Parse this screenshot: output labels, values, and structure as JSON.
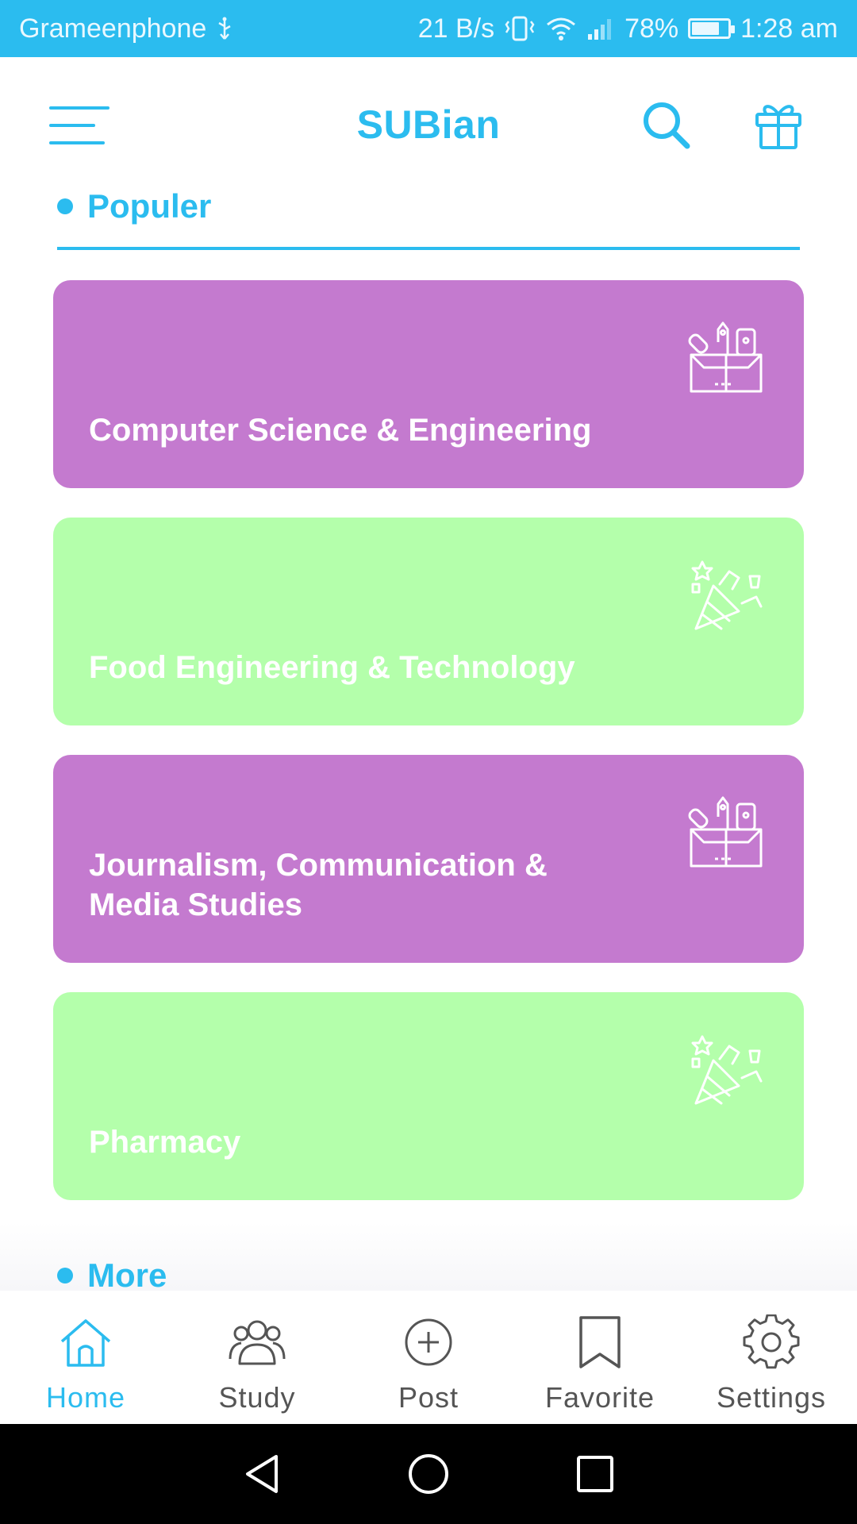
{
  "status_bar": {
    "carrier": "Grameenphone",
    "net_speed": "21 B/s",
    "battery": "78%",
    "time": "1:28 am"
  },
  "header": {
    "title": "SUBian",
    "icons": [
      "menu-icon",
      "search-icon",
      "gift-icon"
    ]
  },
  "sections": {
    "popular_title": "Populer",
    "more_title": "More"
  },
  "cards": [
    {
      "label": "Computer Science & Engineering",
      "color": "#c47acf",
      "icon": "toolbox-icon"
    },
    {
      "label": "Food Engineering & Technology",
      "color": "#b4ffab",
      "icon": "party-popper-icon"
    },
    {
      "label": "Journalism, Communication & Media Studies",
      "color": "#c47acf",
      "icon": "toolbox-icon"
    },
    {
      "label": "Pharmacy",
      "color": "#b4ffab",
      "icon": "party-popper-icon"
    }
  ],
  "bottom_nav": {
    "items": [
      {
        "label": "Home",
        "icon": "home-icon",
        "active": true
      },
      {
        "label": "Study",
        "icon": "group-icon",
        "active": false
      },
      {
        "label": "Post",
        "icon": "add-circle-icon",
        "active": false
      },
      {
        "label": "Favorite",
        "icon": "bookmark-icon",
        "active": false
      },
      {
        "label": "Settings",
        "icon": "gear-icon",
        "active": false
      }
    ]
  },
  "colors": {
    "accent": "#2bbcef",
    "card_purple": "#c47acf",
    "card_green": "#b4ffab",
    "system_nav": "#000000"
  }
}
